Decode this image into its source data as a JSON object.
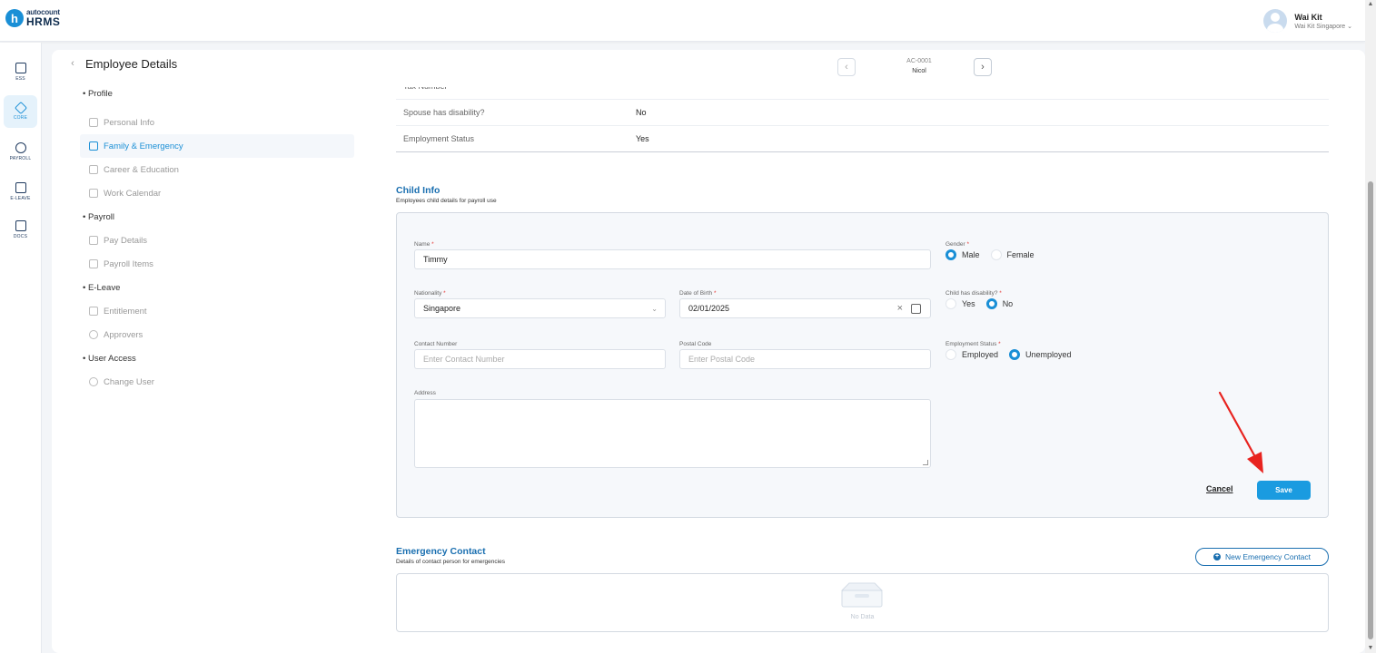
{
  "app": {
    "logo_small": "autocount",
    "logo_big": "HRMS",
    "logo_letter": "h"
  },
  "user": {
    "name": "Wai Kit",
    "org": "Wai Kit Singapore ⌄"
  },
  "rail": [
    {
      "label": "ESS",
      "icon": "ess-icon"
    },
    {
      "label": "CORE",
      "icon": "core-icon"
    },
    {
      "label": "PAYROLL",
      "icon": "payroll-icon"
    },
    {
      "label": "E-LEAVE",
      "icon": "calendar-icon"
    },
    {
      "label": "DOCS",
      "icon": "docs-icon"
    }
  ],
  "header": {
    "title": "Employee Details",
    "employee_code": "AC-0001",
    "employee_name": "Nicol",
    "prev_icon": "‹",
    "next_icon": "›",
    "back_icon": "‹"
  },
  "menu": {
    "profile": "• Profile",
    "personal_info": "Personal Info",
    "family_emergency": "Family & Emergency",
    "career_education": "Career & Education",
    "work_calendar": "Work Calendar",
    "payroll": "• Payroll",
    "pay_details": "Pay Details",
    "payroll_items": "Payroll Items",
    "eleave": "• E-Leave",
    "entitlement": "Entitlement",
    "approvers": "Approvers",
    "user_access": "• User Access",
    "change_user": "Change User"
  },
  "spouse": {
    "rows": [
      {
        "key": "Tax Number",
        "value": "-"
      },
      {
        "key": "Spouse has disability?",
        "value": "No"
      },
      {
        "key": "Employment Status",
        "value": "Yes"
      }
    ]
  },
  "child": {
    "title": "Child Info",
    "subtitle": "Employees child details for payroll use",
    "name_label": "Name",
    "name_value": "Timmy",
    "gender_label": "Gender",
    "gender_male": "Male",
    "gender_female": "Female",
    "nationality_label": "Nationality",
    "nationality_value": "Singapore",
    "dob_label": "Date of Birth",
    "dob_value": "02/01/2025",
    "disability_label": "Child has disability?",
    "disability_yes": "Yes",
    "disability_no": "No",
    "contact_label": "Contact Number",
    "contact_placeholder": "Enter Contact Number",
    "postal_label": "Postal Code",
    "postal_placeholder": "Enter Postal Code",
    "emp_status_label": "Employment Status",
    "emp_employed": "Employed",
    "emp_unemployed": "Unemployed",
    "address_label": "Address",
    "required_mark": "*",
    "cancel": "Cancel",
    "save": "Save"
  },
  "emergency": {
    "title": "Emergency Contact",
    "subtitle": "Details of contact person for emergencies",
    "new_button": "New Emergency Contact",
    "no_data": "No Data"
  },
  "colors": {
    "accent": "#1a8fd6",
    "save": "#1a9be0",
    "arrow": "#e8231f"
  }
}
